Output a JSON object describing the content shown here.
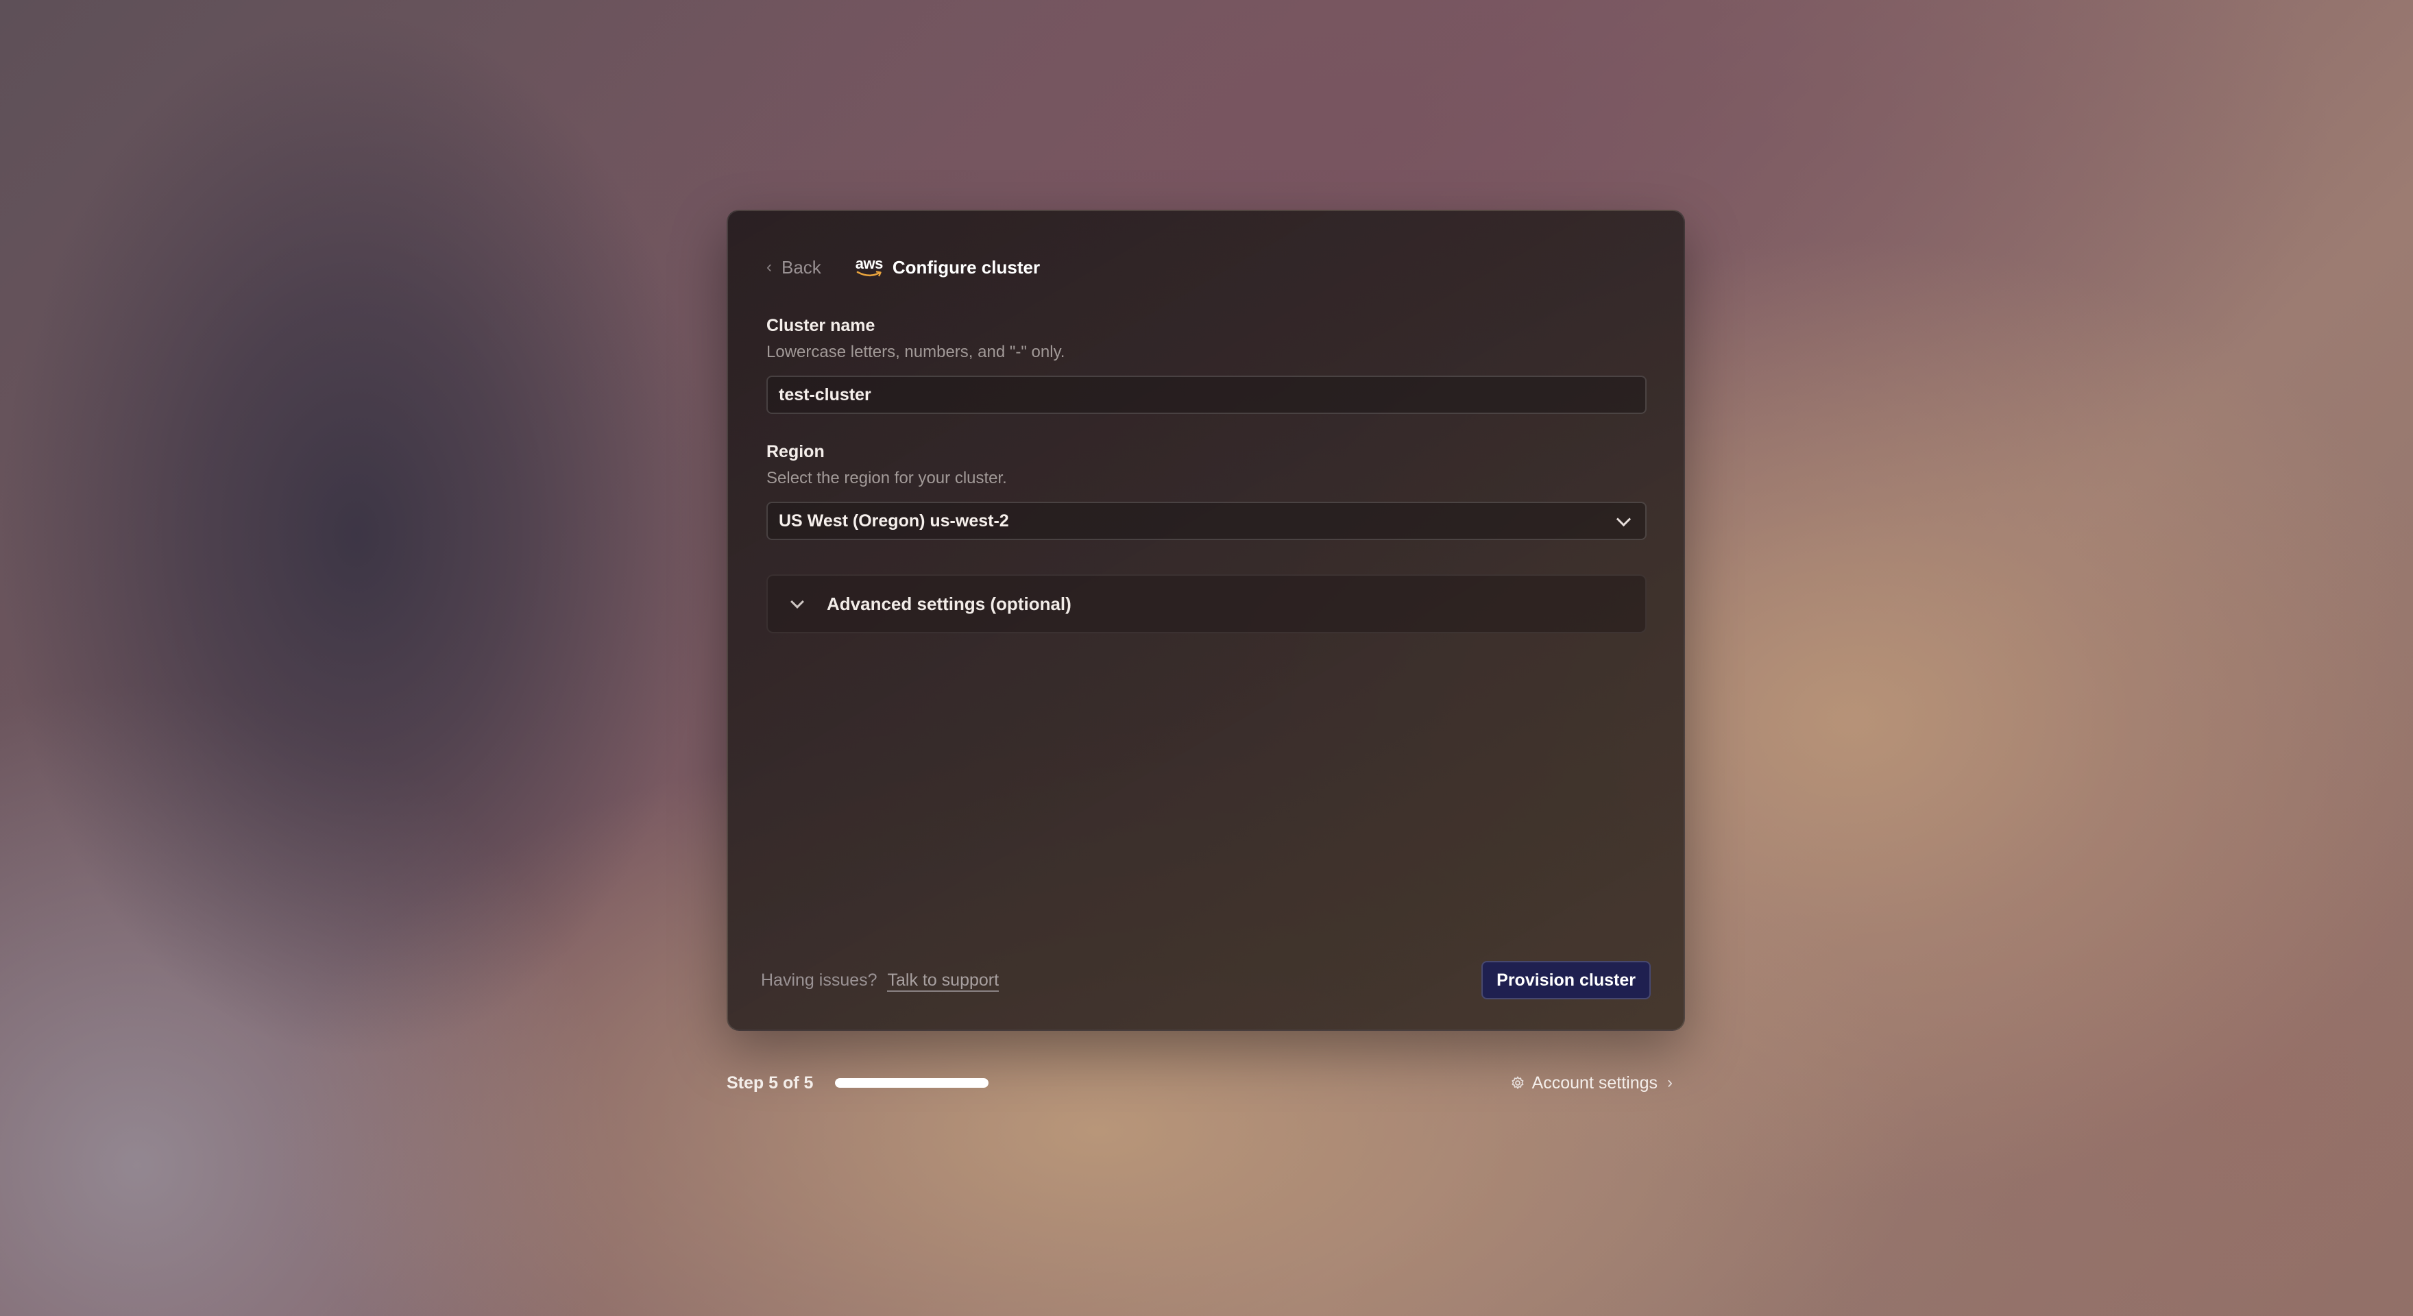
{
  "header": {
    "back_label": "Back",
    "logo_text": "aws",
    "title": "Configure cluster"
  },
  "cluster_name": {
    "label": "Cluster name",
    "help": "Lowercase letters, numbers, and \"-\" only.",
    "value": "test-cluster"
  },
  "region": {
    "label": "Region",
    "help": "Select the region for your cluster.",
    "selected": "US West (Oregon) us-west-2"
  },
  "advanced": {
    "label": "Advanced settings (optional)"
  },
  "footer": {
    "issues_text": "Having issues?",
    "support_link": "Talk to support",
    "primary_button": "Provision cluster"
  },
  "steps": {
    "label": "Step 5 of 5",
    "current": 5,
    "total": 5,
    "progress_fraction": 1.0
  },
  "account": {
    "label": "Account settings"
  },
  "icons": {
    "back": "chevron-left-icon",
    "region_dropdown": "chevron-down-icon",
    "advanced_toggle": "chevron-down-icon",
    "account": "gear-icon",
    "account_arrow": "chevron-right-icon"
  },
  "colors": {
    "primary_button_bg": "#1f2050",
    "card_bg": "#2c2222",
    "progress_fill": "#ffffff"
  }
}
